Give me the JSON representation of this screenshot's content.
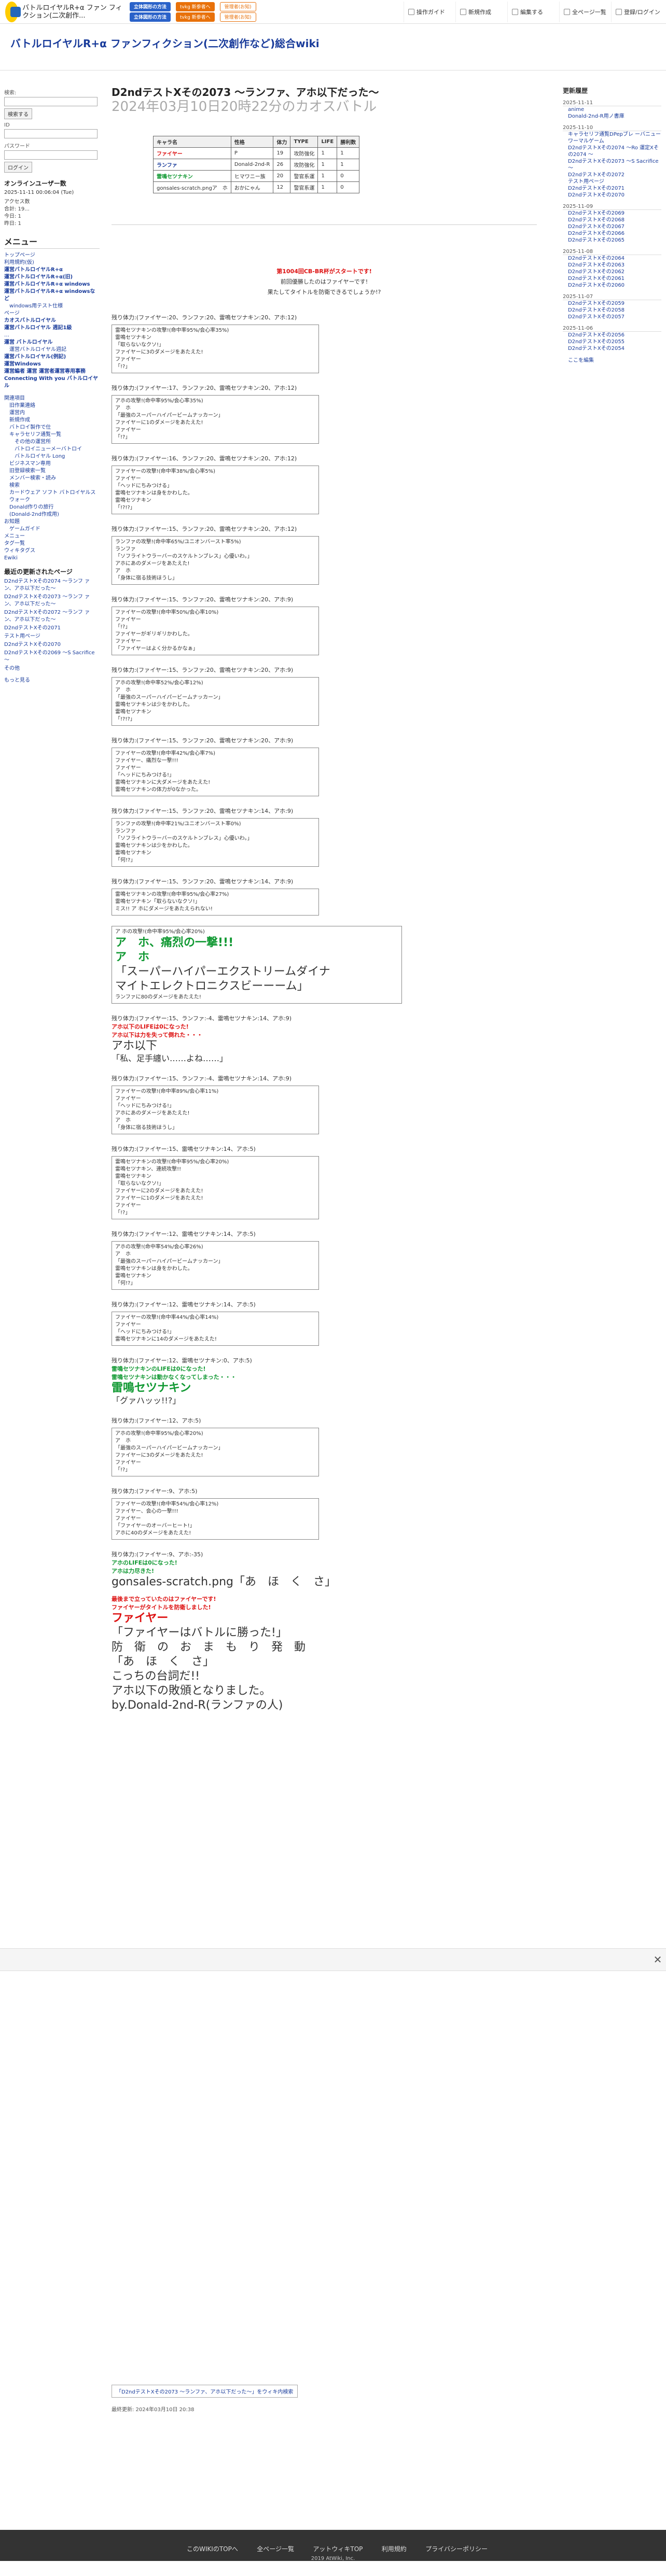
{
  "topbar": {
    "logo_text": "バトルロイヤルR+α ファン フィクション(二次創作...",
    "ads": [
      "立体図形の方法",
      "立体図形の方法",
      "tvkg 新参者へ",
      "tvkg 新参者へ"
    ],
    "ads2": [
      "管理者(お知)",
      "管理者(お知)"
    ],
    "menu": [
      "操作ガイド",
      "新規作成",
      "編集する",
      "全ページ一覧",
      "登録/ログイン"
    ]
  },
  "site_title": "バトルロイヤルR+α ファンフィクション(二次創作など)総合wiki",
  "left": {
    "search_label": "検索:",
    "search_button": "検索する",
    "sub_label": "ログイン",
    "id_label": "ID",
    "pw_label": "パスワード",
    "login_button": "ログイン",
    "online_title": "オンラインユーザー数",
    "online_count": "2025-11-11 00:06:04 (Tue)",
    "stats": [
      "アクセス数",
      "合計: 19...",
      "今日: 1",
      "昨日: 1"
    ],
    "menu_title": "メニュー",
    "menu_links": [
      {
        "t": "トップページ",
        "c": ""
      },
      {
        "t": "利用規約(仮)",
        "c": ""
      },
      {
        "t": "運営バトルロイヤルR+α",
        "c": "bold"
      },
      {
        "t": "運営バトルロイヤルR+α(旧)",
        "c": "bold"
      },
      {
        "t": "運営バトルロイヤルR+α windows",
        "c": "bold"
      },
      {
        "t": "運営バトルロイヤルR+α windowsなど",
        "c": "bold"
      },
      {
        "t": "windows用テスト仕様",
        "c": "ind"
      },
      {
        "t": "ページ",
        "c": ""
      },
      {
        "t": "カオスバトルロイヤル",
        "c": "bold"
      },
      {
        "t": "運営バトルロイヤル 週記1級",
        "c": "bold"
      },
      {
        "t": "…",
        "c": ""
      },
      {
        "t": "運営 バトルロイヤル",
        "c": "bold"
      },
      {
        "t": "運営バトルロイヤル週記",
        "c": "ind"
      },
      {
        "t": "運営バトルロイヤル(例記)",
        "c": "bold"
      },
      {
        "t": "運営Windows",
        "c": "bold"
      },
      {
        "t": "運営編者 運営 運営者運営専用事務",
        "c": "bold"
      },
      {
        "t": "Connecting With you バトルロイヤル",
        "c": "bold"
      }
    ],
    "sub_menu": [
      {
        "t": "関連項目",
        "c": ""
      },
      {
        "t": "旧作業連絡",
        "c": "ind"
      },
      {
        "t": "運営内",
        "c": "ind"
      },
      {
        "t": "新規作成",
        "c": "ind"
      },
      {
        "t": "バトロイ製作で仕",
        "c": "ind"
      },
      {
        "t": "キャラセリフ通覧一覧",
        "c": "ind"
      },
      {
        "t": "その他の運営所",
        "c": "ind2"
      },
      {
        "t": "バトロイニューメーバトロイ",
        "c": "ind2"
      },
      {
        "t": "バトルロイヤル Long",
        "c": "ind2"
      },
      {
        "t": "ビジネスマン専用",
        "c": "ind"
      },
      {
        "t": "旧登録検索一覧",
        "c": "ind"
      },
      {
        "t": "メンバー検索・読み",
        "c": "ind"
      },
      {
        "t": "検索",
        "c": "ind"
      },
      {
        "t": "カードウェア ソフト バトロイヤルス ウォーク",
        "c": "ind"
      },
      {
        "t": "Donald作りの旅行",
        "c": "ind"
      },
      {
        "t": "(Donald-2nd作成用)",
        "c": "ind"
      },
      {
        "t": "お知題",
        "c": ""
      },
      {
        "t": "ゲームガイド",
        "c": "ind"
      },
      {
        "t": "メニュー",
        "c": ""
      },
      {
        "t": "タグ一覧",
        "c": ""
      },
      {
        "t": "ウィキタグス",
        "c": ""
      },
      {
        "t": "Ewiki",
        "c": ""
      }
    ],
    "recent_title": "最近の更新されたページ",
    "recent": [
      "D2ndテストXその2074 ～ランフ ァン、アホ以下だった～",
      "D2ndテストXその2073 ～ランフ ァン、アホ以下だった～",
      "D2ndテストXその2072 ～ランフ ァン、アホ以下だった～",
      "D2ndテストXその2071",
      "テスト用ページ",
      "D2ndテストXその2070",
      "D2ndテストXその2069 ～S Sacrifice～",
      "その他"
    ],
    "more": "もっと見る"
  },
  "main": {
    "title": "D2ndテストXその2073 ～ランファ、アホ以下だった～",
    "subtitle": "2024年03月10日20時22分のカオスバトル",
    "table_headers": [
      "キャラ名",
      "性格",
      "体力",
      "TYPE",
      "LIFE",
      "勝利数"
    ],
    "table_rows": [
      [
        "ファイヤー",
        "P",
        "19",
        "攻防強化",
        "1",
        "1"
      ],
      [
        "ランファ",
        "Donald-2nd-R",
        "26",
        "攻防強化",
        "1",
        "1"
      ],
      [
        "雷鳴セツナキン",
        "ヒマワニー族",
        "20",
        "警官系運",
        "1",
        "0"
      ],
      [
        "gonsales-scratch.pngア　ホ",
        "おかにゃん",
        "12",
        "警官系運",
        "1",
        "0"
      ]
    ],
    "intro_lines": [
      "第1004回CB-BR杯がスタートです!",
      "前回優勝したのはファイヤーです!",
      "果たしてタイトルを防衛できるでしょうか!?"
    ],
    "battle": [
      {
        "turn": "残り体力:(ファイヤー:20、ランファ:20、雷鳴セツナキン:20、アホ:12)",
        "box": [
          "雷鳴セツナキンの攻撃!(命中率95%/会心率35%)",
          "雷鳴セツナキン",
          "「取らないなクソ!」",
          "ファイヤーに3のダメージをあたえた!",
          "ファイヤー",
          "「!?」"
        ]
      },
      {
        "turn": "残り体力:(ファイヤー:17、ランファ:20、雷鳴セツナキン:20、アホ:12)",
        "box": [
          "アホの攻撃!(命中率95%/会心率35%)",
          "ア　ホ",
          "「最強のスーパーハイパービームナッカーン」",
          "ファイヤーに1のダメージをあたえた!",
          "ファイヤー",
          "「!?」"
        ]
      },
      {
        "turn": "残り体力:(ファイヤー:16、ランファ:20、雷鳴セツナキン:20、アホ:12)",
        "box": [
          "ファイヤーの攻撃!(命中率38%/会心率5%)",
          "ファイヤー",
          "「ヘッドにちみつける」",
          "雷鳴セツナキンは身をかわした。",
          "雷鳴セツナキン",
          "「!?!?」"
        ]
      },
      {
        "turn": "残り体力:(ファイヤー:15、ランファ:20、雷鳴セツナキン:20、アホ:12)",
        "box": [
          "ランファの攻撃!(命中率65%/ユニオンバースト率5%)",
          "ランファ",
          "「ソフライトウラーバーのスケルトンブレス」心優いわ。」",
          "アホにあのダメージをあたえた!",
          "ア　ホ",
          "「身体に宿る技術ほうし」"
        ]
      },
      {
        "turn": "残り体力:(ファイヤー:15、ランファ:20、雷鳴セツナキン:20、アホ:9)",
        "box": [
          "ファイヤーの攻撃!(命中率50%/会心率10%)",
          "ファイヤー",
          "「!?」",
          "ファイヤーがギリギリかわした。",
          "ファイヤー",
          "「ファイヤーはよく分かるかなぁ」"
        ]
      },
      {
        "turn": "残り体力:(ファイヤー:15、ランファ:20、雷鳴セツナキン:20、アホ:9)",
        "box": [
          "アホの攻撃!(命中率52%/会心率12%)",
          "ア　ホ",
          "「最強のスーパーハイパービームナッカーン」",
          "雷鳴セツナキンは少をかわした。",
          "雷鳴セツナキン",
          "「!?!?」"
        ]
      },
      {
        "turn": "残り体力:(ファイヤー:15、ランファ:20、雷鳴セツナキン:20、アホ:9)",
        "box": [
          "ファイヤーの攻撃!(命中率42%/会心率7%)",
          "ファイヤー、痛烈な一撃!!!",
          "ファイヤー",
          "「ヘッドにちみつける!」",
          "雷鳴セツナキンに大ダメージをあたえた!",
          "雷鳴セツナキンの体力が0なかった。"
        ]
      },
      {
        "turn": "残り体力:(ファイヤー:15、ランファ:20、雷鳴セツナキン:14、アホ:9)",
        "box": [
          "ランファの攻撃!(命中率21%/ユニオンバースト率0%)",
          "ランファ",
          "「ソフライトウラーバーのスケルトンブレス」心優いわ。」",
          "雷鳴セツナキンは少をかわした。",
          "雷鳴セツナキン",
          "「何!?」"
        ]
      },
      {
        "turn": "残り体力:(ファイヤー:15、ランファ:20、雷鳴セツナキン:14、アホ:9)",
        "box": [
          "雷鳴セツナキンの攻撃!(命中率95%/会心率27%)",
          "雷鳴セツナキン「取らないなクソ!」",
          "ミス!! ア ホにダメージをあたえられない!"
        ]
      }
    ],
    "big_attack": [
      "ア ホの攻撃!(命中率95%/会心率20%)",
      "ア　ホ、痛烈の一撃!!!",
      "ア　ホ",
      "「スーパーハイパーエクストリームダイナ",
      "マイトエレクトロニクスビーーーム」",
      "ランファに80のダメージをあたえた!"
    ],
    "after_big": [
      "残り体力:(ファイヤー:15、ランファ:-4、雷鳴セツナキン:14、アホ:9)",
      "アホ以下のLIFEは0になった!",
      "アホ以下は力を失って倒れた・・・",
      "アホ以下",
      "「私、足手纏い……よね……」"
    ],
    "battle2": [
      {
        "turn": "残り体力:(ファイヤー:15、ランファ:-4、雷鳴セツナキン:14、アホ:9)",
        "box": [
          "ファイヤーの攻撃!(命中率89%/会心率11%)",
          "ファイヤー",
          "「ヘッドにちみつける!」",
          "アホにあのダメージをあたえた!",
          "ア　ホ",
          "「身体に宿る技術ほうし」"
        ]
      },
      {
        "turn": "残り体力:(ファイヤー:15、雷鳴セツナキン:14、アホ:5)",
        "box": [
          "雷鳴セツナキンの攻撃!(命中率95%/会心率20%)",
          "雷鳴セツナキン、連続攻撃!!",
          "雷鳴セツナキン",
          "「取らないなクソ!」",
          "ファイヤーに2のダメージをあたえた!",
          "ファイヤーに1のダメージをあたえた!",
          "ファイヤー",
          "「!?」"
        ]
      },
      {
        "turn": "残り体力:(ファイヤー:12、雷鳴セツナキン:14、アホ:5)",
        "box": [
          "アホの攻撃!(命中率54%/会心率26%)",
          "ア　ホ",
          "「最強のスーパーハイパービームナッカーン」",
          "雷鳴セツナキンは身をかわした。",
          "雷鳴セツナキン",
          "「何!?」"
        ]
      },
      {
        "turn": "残り体力:(ファイヤー:12、雷鳴セツナキン:14、アホ:5)",
        "box": [
          "ファイヤーの攻撃!(命中率44%/会心率14%)",
          "ファイヤー",
          "「ヘッドにちみつける!」",
          "雷鳴セツナキンに14のダメージをあたえた!"
        ]
      }
    ],
    "setsuna_fall": [
      "残り体力:(ファイヤー:12、雷鳴セツナキン:0、アホ:5)",
      "雷鳴セツナキンのLIFEは0になった!",
      "雷鳴セツナキンは動かなくなってしまった・・・",
      "雷鳴セツナキン",
      "「グァハッッ!!?」"
    ],
    "battle3": [
      {
        "turn": "残り体力:(ファイヤー:12、アホ:5)",
        "box": [
          "アホの攻撃!(命中率95%/会心率20%)",
          "ア　ホ",
          "「最強のスーパーハイパービームナッカーン」",
          "ファイヤーに3のダメージをあたえた!",
          "ファイヤー",
          "「!?」"
        ]
      },
      {
        "turn": "残り体力:(ファイヤー:9、アホ:5)",
        "box": [
          "ファイヤーの攻撃!(命中率54%/会心率12%)",
          "ファイヤー、会心の一撃!!!",
          "ファイヤー",
          "「ファイヤーのオーバーヒート!」",
          "アホに40のダメージをあたえた!"
        ]
      }
    ],
    "ending": [
      "残り体力:(ファイヤー:9、アホ:-35)",
      "アホのLIFEは0になった!",
      "アホは力尽きた!",
      "gonsales-scratch.png「あ　ほ　く　さ」",
      "最後まで立っていたのはファイヤーです!",
      "ファイヤーがタイトルを防衛しました!",
      "ファイヤー",
      "「ファイヤーはバトルに勝った!」",
      "防　衛　の　お　ま　も　り　発　動",
      "「あ　ほ　く　さ」",
      "こっちの台詞だ!!",
      "アホ以下の敗頒となりました。",
      "by.Donald-2nd-R(ランファの人)"
    ],
    "backlink": "「D2ndテストXその2073 ～ランファ、アホ以下だった～」をウィキ内検索",
    "last_updated": "最終更新: 2024年03月10日 20:38"
  },
  "right": {
    "title": "更新履歴",
    "groups": [
      {
        "date": "2025-11-11",
        "items": [
          "anime",
          "Donald-2nd-R用ノ書庫"
        ]
      },
      {
        "date": "2025-11-10",
        "items": [
          "キャラセリフ通覧DPepブレ ーバニューワーマルゲーム",
          "D2ndテストXその2074 ～Ro 運定Xその2074 ～",
          "D2ndテストXその2073 ～S Sacrifice～",
          "D2ndテストXその2072",
          "テスト用ページ",
          "D2ndテストXその2071",
          "D2ndテストXその2070"
        ]
      },
      {
        "date": "2025-11-09",
        "items": [
          "D2ndテストXその2069",
          "D2ndテストXその2068",
          "D2ndテストXその2067",
          "D2ndテストXその2066",
          "D2ndテストXその2065"
        ]
      },
      {
        "date": "2025-11-08",
        "items": [
          "D2ndテストXその2064",
          "D2ndテストXその2063",
          "D2ndテストXその2062",
          "D2ndテストXその2061",
          "D2ndテストXその2060"
        ]
      },
      {
        "date": "2025-11-07",
        "items": [
          "D2ndテストXその2059",
          "D2ndテストXその2058",
          "D2ndテストXその2057"
        ]
      },
      {
        "date": "2025-11-06",
        "items": [
          "D2ndテストXその2056",
          "D2ndテストXその2055",
          "D2ndテストXその2054"
        ]
      }
    ],
    "more": "ここを編集"
  },
  "footer": {
    "links": [
      "このWIKIのTOPへ",
      "全ページ一覧",
      "アットウィキTOP",
      "利用規約",
      "プライバシーポリシー"
    ],
    "copy": "2019 AtWiki, Inc."
  }
}
